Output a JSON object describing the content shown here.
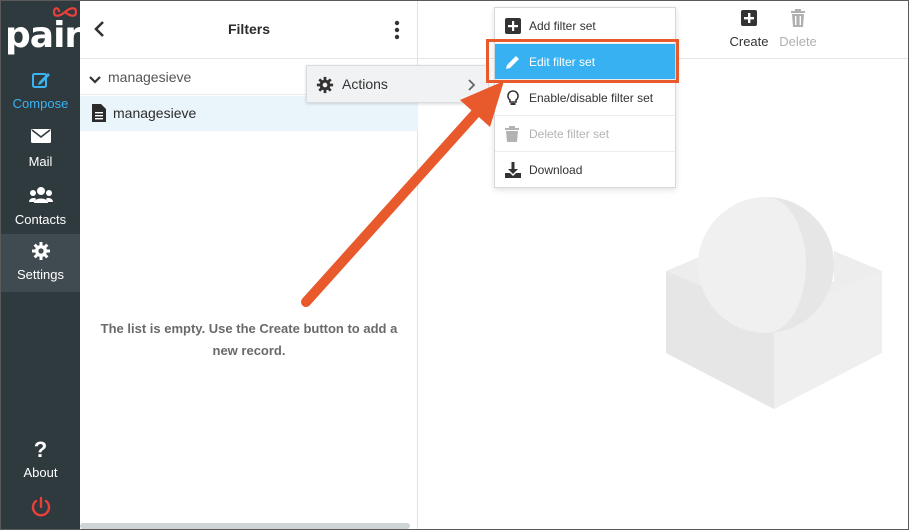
{
  "app": {
    "logo_text": "pair"
  },
  "sidebar": {
    "items": [
      {
        "label": "Compose",
        "icon": "compose-icon"
      },
      {
        "label": "Mail",
        "icon": "mail-icon"
      },
      {
        "label": "Contacts",
        "icon": "contacts-icon"
      },
      {
        "label": "Settings",
        "icon": "gear-icon"
      }
    ],
    "about": {
      "label": "About",
      "icon": "question-icon"
    },
    "logout_icon": "power-icon"
  },
  "filters_panel": {
    "title": "Filters",
    "group": {
      "name": "managesieve",
      "expanded": true
    },
    "file": {
      "name": "managesieve",
      "selected": true
    },
    "empty_message": "The list is empty. Use the Create button to add a new record."
  },
  "toolbar": {
    "create_label": "Create",
    "delete_label": "Delete"
  },
  "actions_menu": {
    "label": "Actions",
    "items": [
      {
        "label": "Add filter set",
        "icon": "plus-square-icon",
        "state": "enabled"
      },
      {
        "label": "Edit filter set",
        "icon": "pencil-icon",
        "state": "highlighted"
      },
      {
        "label": "Enable/disable filter set",
        "icon": "lightbulb-icon",
        "state": "enabled"
      },
      {
        "label": "Delete filter set",
        "icon": "trash-icon",
        "state": "disabled"
      },
      {
        "label": "Download",
        "icon": "download-icon",
        "state": "enabled"
      }
    ]
  },
  "colors": {
    "sidebar_bg": "#2f3a3f",
    "accent": "#37b1f1",
    "annotation": "#e8592c",
    "logo_accent": "#e8403a"
  }
}
